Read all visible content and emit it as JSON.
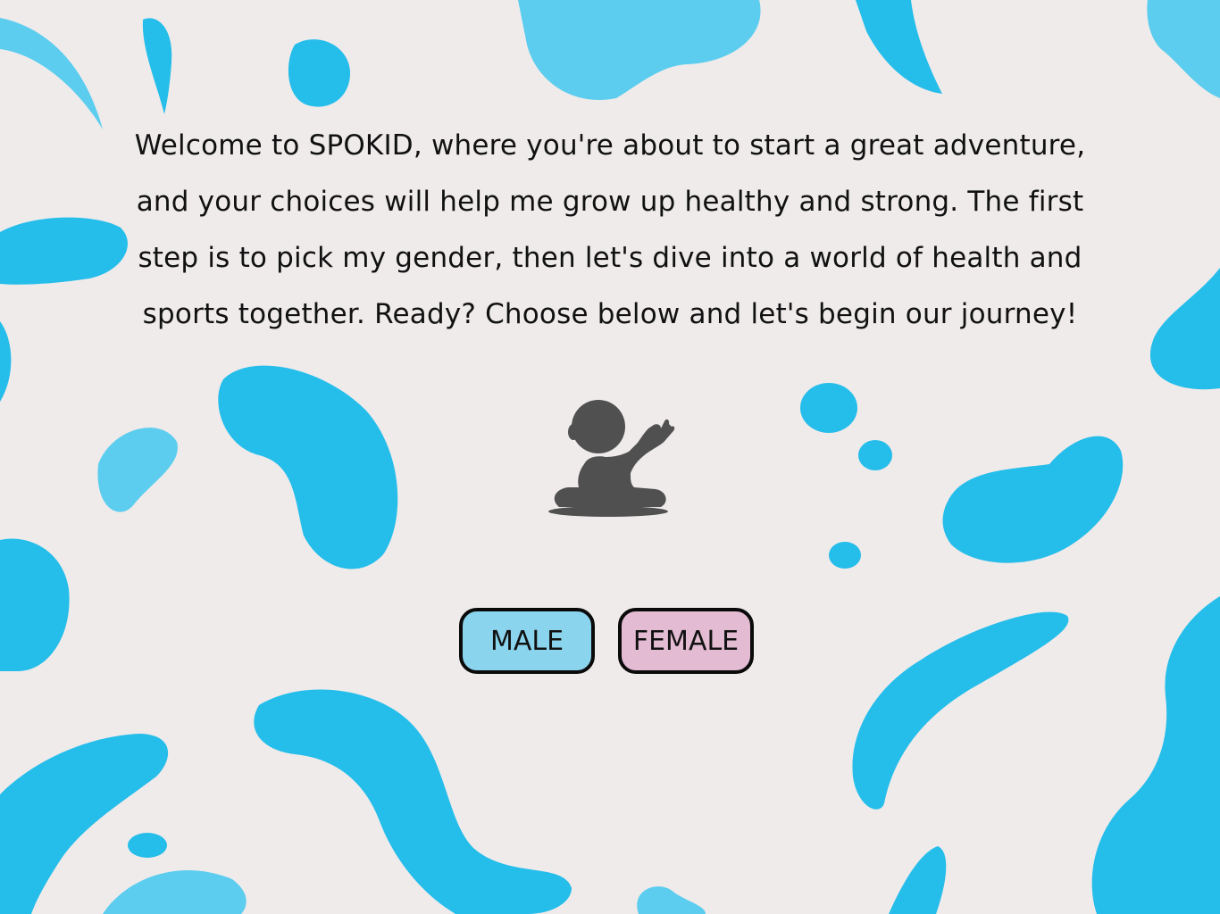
{
  "intro": {
    "text": "Welcome to SPOKID, where you're about to start a great adventure, and your choices will help me grow up healthy and strong. The first step is to pick my gender, then let's dive into a world of health and sports together. Ready? Choose below and let's begin our journey!"
  },
  "gender_buttons": {
    "male_label": "MALE",
    "female_label": "FEMALE",
    "male_color": "#8bd4ee",
    "female_color": "#e3bbd3"
  },
  "avatar": {
    "icon": "waving-baby-silhouette-icon",
    "color": "#505050"
  },
  "theme": {
    "background": "#efebeb",
    "blob_primary": "#25bdea",
    "blob_light": "#5ccdee"
  }
}
